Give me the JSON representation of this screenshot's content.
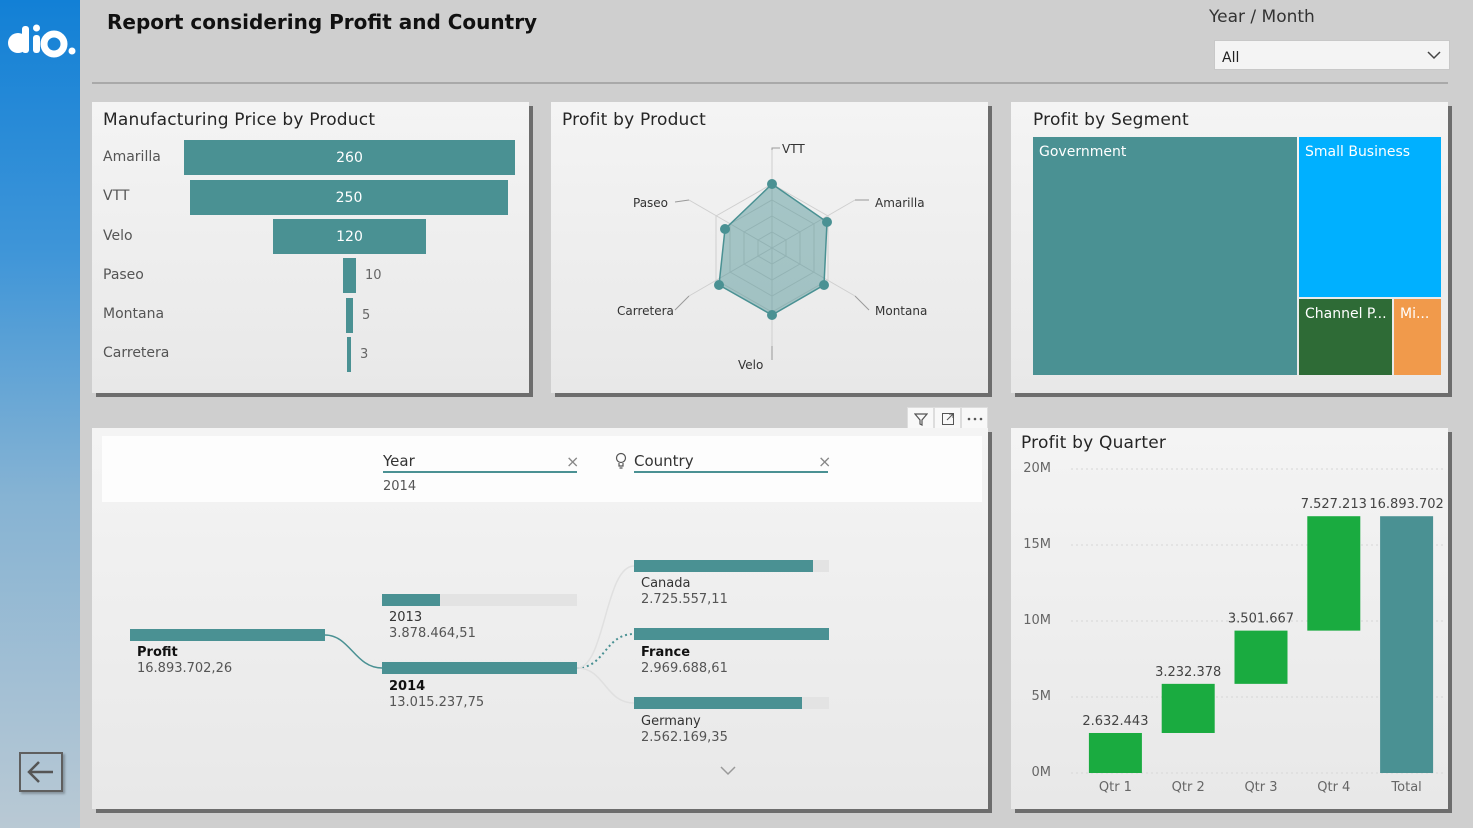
{
  "header": {
    "title": "Report considering Profit and Country",
    "slicer_label": "Year / Month",
    "slicer_value": "All"
  },
  "colors": {
    "teal": "#4a9193",
    "green": "#1aab40",
    "dark_green": "#2e6b36",
    "sky_blue": "#00b0ff",
    "orange": "#f19a4b"
  },
  "manufacturing": {
    "title": "Manufacturing Price by Product",
    "items": [
      {
        "label": "Amarilla",
        "value": "260"
      },
      {
        "label": "VTT",
        "value": "250"
      },
      {
        "label": "Velo",
        "value": "120"
      },
      {
        "label": "Paseo",
        "value": "10"
      },
      {
        "label": "Montana",
        "value": "5"
      },
      {
        "label": "Carretera",
        "value": "3"
      }
    ]
  },
  "radar": {
    "title": "Profit by Product",
    "axes": [
      "VTT",
      "Amarilla",
      "Montana",
      "Velo",
      "Carretera",
      "Paseo"
    ]
  },
  "segment": {
    "title": "Profit by Segment",
    "items": [
      "Government",
      "Small Business",
      "Channel P...",
      "Mi..."
    ]
  },
  "decomposition": {
    "levels": [
      {
        "title": "Year",
        "selected": "2014"
      },
      {
        "title": "Country"
      }
    ],
    "root": {
      "label": "Profit",
      "value": "16.893.702,26"
    },
    "years": [
      {
        "label": "2013",
        "value": "3.878.464,51"
      },
      {
        "label": "2014",
        "value": "13.015.237,75"
      }
    ],
    "countries": [
      {
        "label": "Canada",
        "value": "2.725.557,11"
      },
      {
        "label": "France",
        "value": "2.969.688,61"
      },
      {
        "label": "Germany",
        "value": "2.562.169,35"
      }
    ]
  },
  "quarter": {
    "title": "Profit by Quarter",
    "y_ticks": [
      "20M",
      "15M",
      "10M",
      "5M",
      "0M"
    ],
    "labels": [
      "2.632.443",
      "3.232.378",
      "3.501.667",
      "7.527.213",
      "16.893.702"
    ]
  },
  "chart_data": {
    "type": "bar",
    "title": "Profit by Quarter",
    "categories": [
      "Qtr 1",
      "Qtr 2",
      "Qtr 3",
      "Qtr 4",
      "Total"
    ],
    "values": [
      2632443,
      3232378,
      3501667,
      7527213,
      16893702
    ],
    "ylim": [
      0,
      20000000
    ]
  }
}
